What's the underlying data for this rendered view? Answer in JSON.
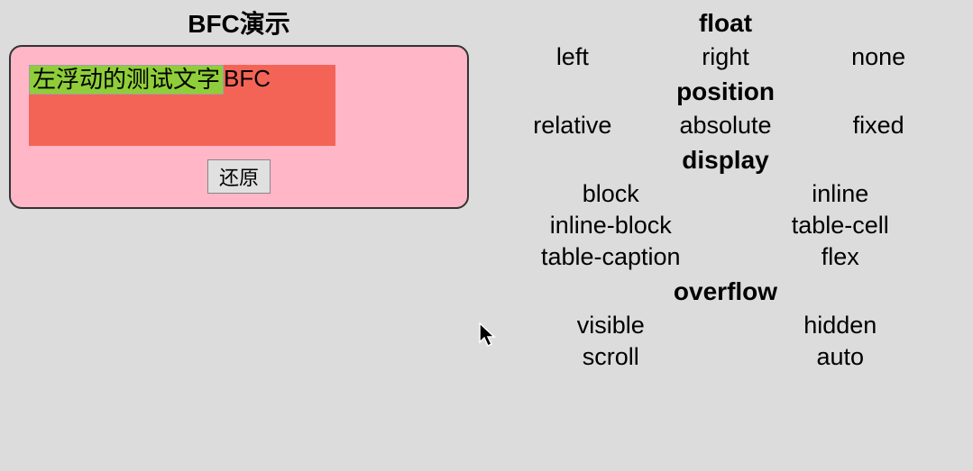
{
  "title": "BFC演示",
  "demo": {
    "float_text": "左浮动的测试文字",
    "bfc_text": "BFC",
    "reset_label": "还原"
  },
  "groups": [
    {
      "title": "float",
      "options": [
        "left",
        "right",
        "none"
      ],
      "cols": "three"
    },
    {
      "title": "position",
      "options": [
        "relative",
        "absolute",
        "fixed"
      ],
      "cols": "three"
    },
    {
      "title": "display",
      "options": [
        "block",
        "inline",
        "inline-block",
        "table-cell",
        "table-caption",
        "flex"
      ],
      "cols": "two"
    },
    {
      "title": "overflow",
      "options": [
        "visible",
        "hidden",
        "scroll",
        "auto"
      ],
      "cols": "two"
    }
  ]
}
